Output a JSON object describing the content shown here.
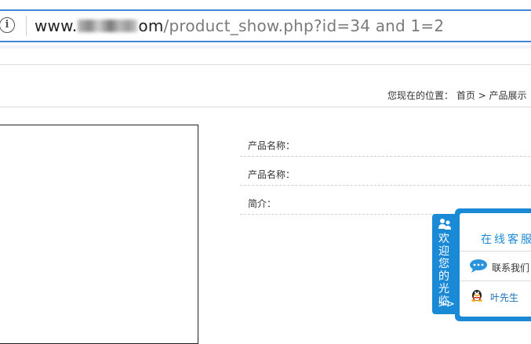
{
  "browser": {
    "url_prefix": "www.",
    "url_tail": "om",
    "url_path": "/product_show.php?id=34 and 1=2"
  },
  "breadcrumb": {
    "text": "您现在的位置： 首页 > 产品展示"
  },
  "product": {
    "fields": [
      {
        "label": "产品名称："
      },
      {
        "label": "产品名称："
      },
      {
        "label": "简介："
      }
    ]
  },
  "float_widget": {
    "tab_text": "欢迎您的光临",
    "arrows": ">>",
    "title": "在线客服",
    "contact_label": "联系我们",
    "agent_name": "叶先生"
  },
  "colors": {
    "accent": "#1b8ad6",
    "address_border": "#3f86d7"
  },
  "icons": [
    "info-icon",
    "people-icon",
    "chat-bubble-icon",
    "qq-penguin-icon"
  ]
}
